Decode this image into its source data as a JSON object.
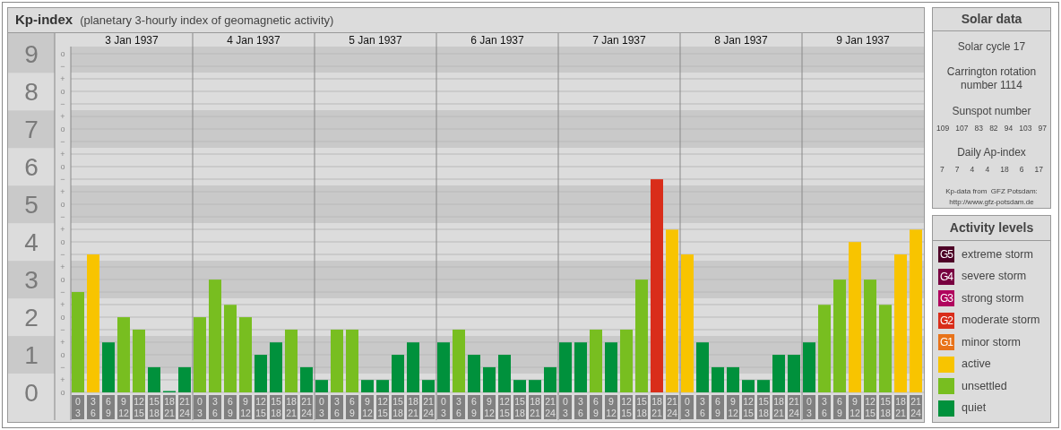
{
  "header": {
    "title": "Kp-index",
    "subtitle": "(planetary 3-hourly index of geomagnetic activity)"
  },
  "chart": {
    "dates": [
      "3 Jan 1937",
      "4 Jan 1937",
      "5 Jan 1937",
      "6 Jan 1937",
      "7 Jan 1937",
      "8 Jan 1937",
      "9 Jan 1937"
    ],
    "tick_marks": [
      "o",
      "−",
      "+",
      "o",
      "−",
      "+",
      "o",
      "−",
      "+",
      "o",
      "−",
      "+",
      "o",
      "−",
      "+",
      "o",
      "−",
      "+",
      "o",
      "−",
      "+",
      "o",
      "−",
      "+",
      "o",
      "−",
      "+",
      "o"
    ],
    "chart_data": {
      "type": "bar",
      "ylim": [
        0,
        9.2
      ],
      "yticks": [
        0,
        1,
        2,
        3,
        4,
        5,
        6,
        7,
        8,
        9
      ],
      "grid": true,
      "categories": [
        "0\n3",
        "3\n6",
        "6\n9",
        "9\n12",
        "12\n15",
        "15\n18",
        "18\n21",
        "21\n24",
        "0\n3",
        "3\n6",
        "6\n9",
        "9\n12",
        "12\n15",
        "15\n18",
        "18\n21",
        "21\n24",
        "0\n3",
        "3\n6",
        "6\n9",
        "9\n12",
        "12\n15",
        "15\n18",
        "18\n21",
        "21\n24",
        "0\n3",
        "3\n6",
        "6\n9",
        "9\n12",
        "12\n15",
        "15\n18",
        "18\n21",
        "21\n24",
        "0\n3",
        "3\n6",
        "6\n9",
        "9\n12",
        "12\n15",
        "15\n18",
        "18\n21",
        "21\n24",
        "0\n3",
        "3\n6",
        "6\n9",
        "9\n12",
        "12\n15",
        "15\n18",
        "18\n21",
        "21\n24",
        "0\n3",
        "3\n6",
        "6\n9",
        "9\n12",
        "12\n15",
        "15\n18",
        "18\n21",
        "21\n24"
      ],
      "values": [
        2.67,
        3.67,
        1.33,
        2,
        1.67,
        0.67,
        0,
        0.67,
        2,
        3,
        2.33,
        2,
        1,
        1.33,
        1.67,
        0.67,
        0.33,
        1.67,
        1.67,
        0.33,
        0.33,
        1,
        1.33,
        0.33,
        1.33,
        1.67,
        1,
        0.67,
        1,
        0.33,
        0.33,
        0.67,
        1.33,
        1.33,
        1.67,
        1.33,
        1.67,
        3,
        5.67,
        4.33,
        3.67,
        1.33,
        0.67,
        0.67,
        0.33,
        0.33,
        1,
        1,
        1.33,
        2.33,
        3,
        4,
        3,
        2.33,
        3.67,
        4.33
      ]
    }
  },
  "solar": {
    "title": "Solar data",
    "cycle": "Solar cycle 17",
    "rotation": "Carrington rotation number 1114",
    "sunspot_label": "Sunspot number",
    "sunspots": [
      "109",
      "107",
      "83",
      "82",
      "94",
      "103",
      "97"
    ],
    "ap_label": "Daily Ap-index",
    "ap": [
      "7",
      "7",
      "4",
      "4",
      "18",
      "6",
      "17"
    ],
    "source": "Kp-data from  GFZ Potsdam:",
    "source_url": "http://www.gfz-potsdam.de"
  },
  "legend": {
    "title": "Activity levels",
    "items": [
      {
        "kind": "badge",
        "badge": "G5",
        "label": "extreme storm",
        "color": "#4d0026"
      },
      {
        "kind": "badge",
        "badge": "G4",
        "label": "severe storm",
        "color": "#780040"
      },
      {
        "kind": "badge",
        "badge": "G3",
        "label": "strong storm",
        "color": "#b0045e"
      },
      {
        "kind": "badge",
        "badge": "G2",
        "label": "moderate storm",
        "color": "#d92d1a"
      },
      {
        "kind": "badge",
        "badge": "G1",
        "label": "minor storm",
        "color": "#e8731a"
      },
      {
        "kind": "swatch",
        "label": "active",
        "color": "#f8c400"
      },
      {
        "kind": "swatch",
        "label": "unsettled",
        "color": "#78be20"
      },
      {
        "kind": "swatch",
        "label": "quiet",
        "color": "#00913c"
      }
    ]
  }
}
